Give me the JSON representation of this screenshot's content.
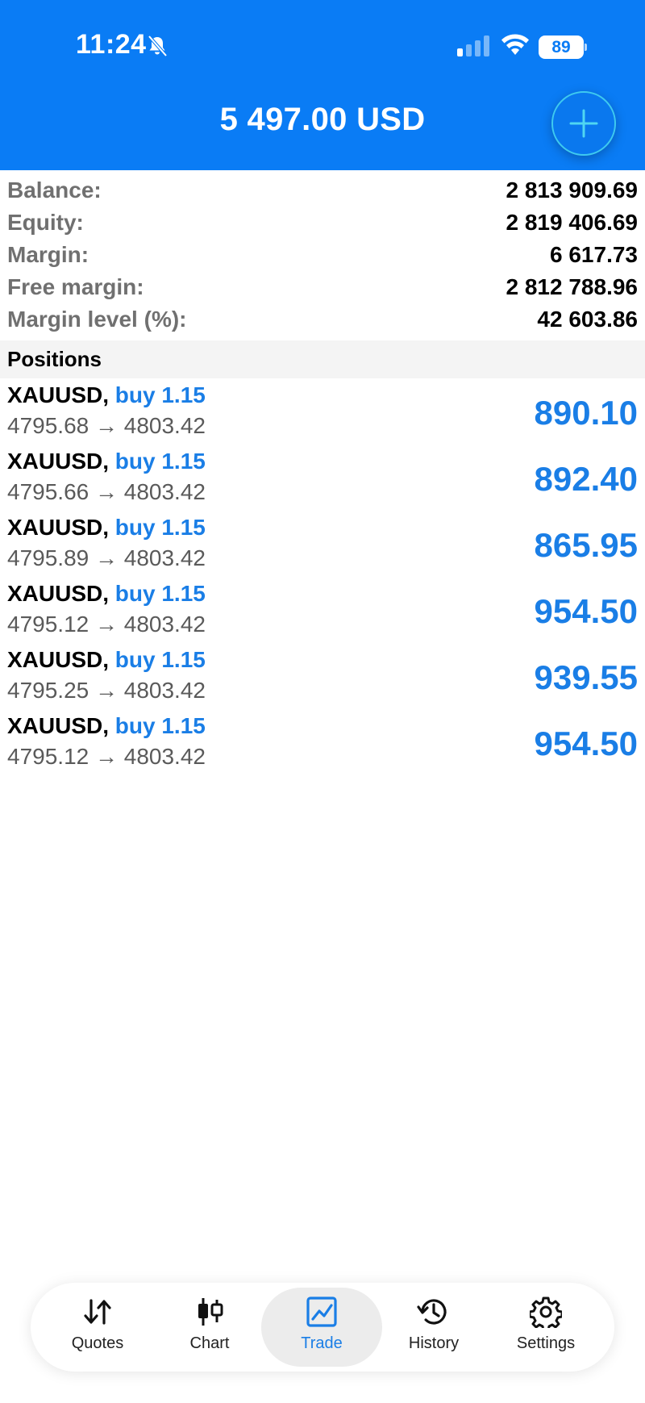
{
  "status_bar": {
    "time": "11:24",
    "battery": "89",
    "icons": [
      "bell-slash-icon",
      "signal-icon",
      "wifi-icon",
      "battery-icon"
    ]
  },
  "header": {
    "balance": "5 497.00 USD",
    "add_icon": "plus-icon",
    "background_color": "#0a7cf5"
  },
  "summary": [
    {
      "label": "Balance:",
      "value": "2 813 909.69"
    },
    {
      "label": "Equity:",
      "value": "2 819 406.69"
    },
    {
      "label": "Margin:",
      "value": "6 617.73"
    },
    {
      "label": "Free margin:",
      "value": "2 812 788.96"
    },
    {
      "label": "Margin level (%):",
      "value": "42 603.86"
    }
  ],
  "positions_title": "Positions",
  "positions": [
    {
      "symbol": "XAUUSD,",
      "side": "buy 1.15",
      "prices": "4795.68 → 4803.42",
      "profit": "890.10"
    },
    {
      "symbol": "XAUUSD,",
      "side": "buy 1.15",
      "prices": "4795.66 → 4803.42",
      "profit": "892.40"
    },
    {
      "symbol": "XAUUSD,",
      "side": "buy 1.15",
      "prices": "4795.89 → 4803.42",
      "profit": "865.95"
    },
    {
      "symbol": "XAUUSD,",
      "side": "buy 1.15",
      "prices": "4795.12 → 4803.42",
      "profit": "954.50"
    },
    {
      "symbol": "XAUUSD,",
      "side": "buy 1.15",
      "prices": "4795.25 → 4803.42",
      "profit": "939.55"
    },
    {
      "symbol": "XAUUSD,",
      "side": "buy 1.15",
      "prices": "4795.12 → 4803.42",
      "profit": "954.50"
    }
  ],
  "tabs": [
    {
      "label": "Quotes",
      "icon": "quotes-arrows-icon",
      "active": false
    },
    {
      "label": "Chart",
      "icon": "candlestick-icon",
      "active": false
    },
    {
      "label": "Trade",
      "icon": "trade-chart-icon",
      "active": true
    },
    {
      "label": "History",
      "icon": "history-clock-icon",
      "active": false
    },
    {
      "label": "Settings",
      "icon": "gear-icon",
      "active": false
    }
  ],
  "colors": {
    "accent": "#1a7ee6",
    "label_gray": "#707070"
  }
}
